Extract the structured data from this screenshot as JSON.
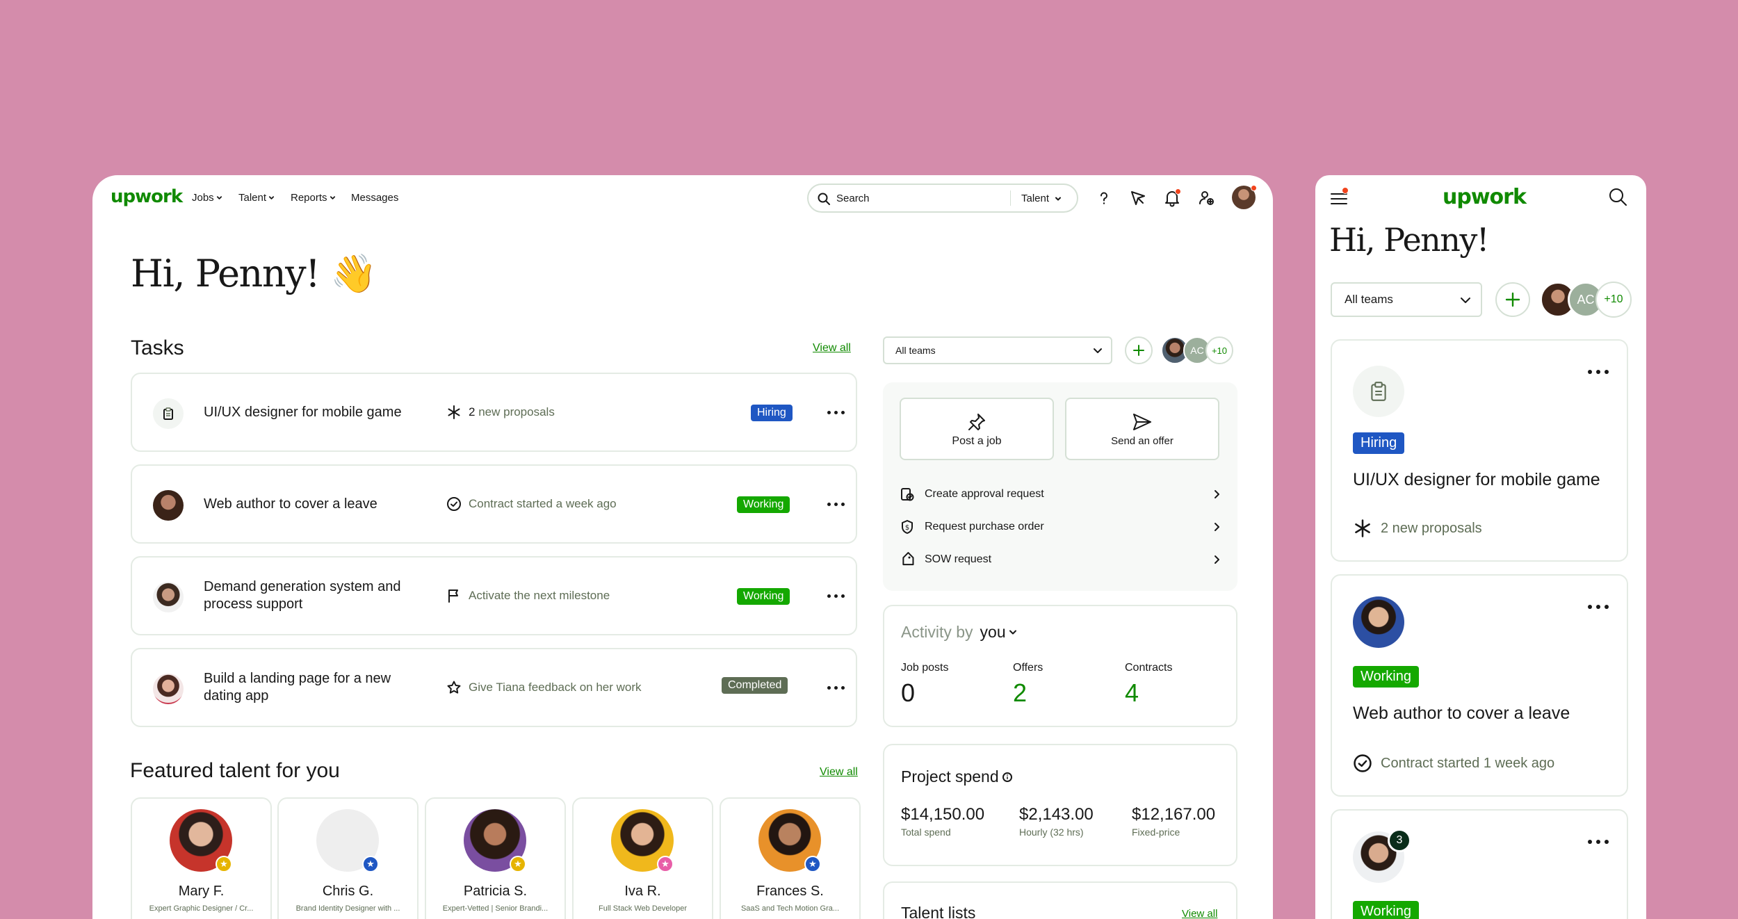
{
  "desktop": {
    "logo": "upwork",
    "nav": [
      {
        "label": "Jobs",
        "dropdown": true
      },
      {
        "label": "Talent",
        "dropdown": true
      },
      {
        "label": "Reports",
        "dropdown": true
      },
      {
        "label": "Messages",
        "dropdown": false
      }
    ],
    "search": {
      "placeholder": "Search",
      "scope": "Talent"
    },
    "greeting": "Hi, Penny!",
    "greeting_emoji": "👋",
    "tasks": {
      "title": "Tasks",
      "view_all": "View all",
      "items": [
        {
          "title": "UI/UX designer for mobile game",
          "meta_count": "2",
          "meta": "new proposals",
          "status": "Hiring",
          "icon": "clipboard-icon"
        },
        {
          "title": "Web author to cover a leave",
          "meta": "Contract started a week ago",
          "status": "Working",
          "icon": "check-circle-icon"
        },
        {
          "title": "Demand generation system and process support",
          "meta": "Activate the next milestone",
          "status": "Working",
          "icon": "flag-icon"
        },
        {
          "title": "Build a landing page for a new dating app",
          "meta": "Give Tiana feedback on her work",
          "status": "Completed",
          "icon": "star-icon"
        }
      ]
    },
    "featured": {
      "title": "Featured talent for you",
      "view_all": "View all",
      "people": [
        {
          "name": "Mary F.",
          "role": "Expert Graphic Designer / Cr...",
          "badge_color": "#e6b400"
        },
        {
          "name": "Chris G.",
          "role": "Brand Identity Designer with ...",
          "badge_color": "#1f57c3"
        },
        {
          "name": "Patricia S.",
          "role": "Expert-Vetted | Senior Brandi...",
          "badge_color": "#e6b400"
        },
        {
          "name": "Iva R.",
          "role": "Full Stack Web Developer",
          "badge_color": "#e85ea8"
        },
        {
          "name": "Frances S.",
          "role": "SaaS and Tech Motion Gra...",
          "badge_color": "#1f57c3"
        }
      ]
    },
    "teams": {
      "selected": "All teams",
      "avatar_initials": "AC",
      "more_count": "+10"
    },
    "actions": {
      "post_job": "Post a job",
      "send_offer": "Send an offer",
      "requests": [
        "Create approval request",
        "Request purchase order",
        "SOW request"
      ]
    },
    "activity": {
      "label": "Activity by",
      "who": "you",
      "stats": [
        {
          "label": "Job posts",
          "value": "0"
        },
        {
          "label": "Offers",
          "value": "2"
        },
        {
          "label": "Contracts",
          "value": "4"
        }
      ]
    },
    "spend": {
      "title": "Project spend",
      "items": [
        {
          "value": "$14,150.00",
          "label": "Total spend"
        },
        {
          "value": "$2,143.00",
          "label": "Hourly (32 hrs)"
        },
        {
          "value": "$12,167.00",
          "label": "Fixed-price"
        }
      ]
    },
    "talent_lists": {
      "title": "Talent lists",
      "view_all": "View all"
    }
  },
  "mobile": {
    "logo": "upwork",
    "greeting": "Hi, Penny!",
    "teams": {
      "selected": "All teams",
      "avatar_initials": "AC",
      "more_count": "+10"
    },
    "cards": [
      {
        "status": "Hiring",
        "title": "UI/UX designer for mobile game",
        "meta": "2 new proposals"
      },
      {
        "status": "Working",
        "title": "Web author to cover a leave",
        "meta": "Contract started 1 week ago"
      },
      {
        "status": "Working",
        "notification_count": "3"
      }
    ]
  },
  "colors": {
    "background": "#d48cab",
    "brand_green": "#108a00",
    "hiring": "#1f57c3",
    "working": "#14a800",
    "completed": "#5e6d55",
    "notification_dot": "#f1441d"
  }
}
